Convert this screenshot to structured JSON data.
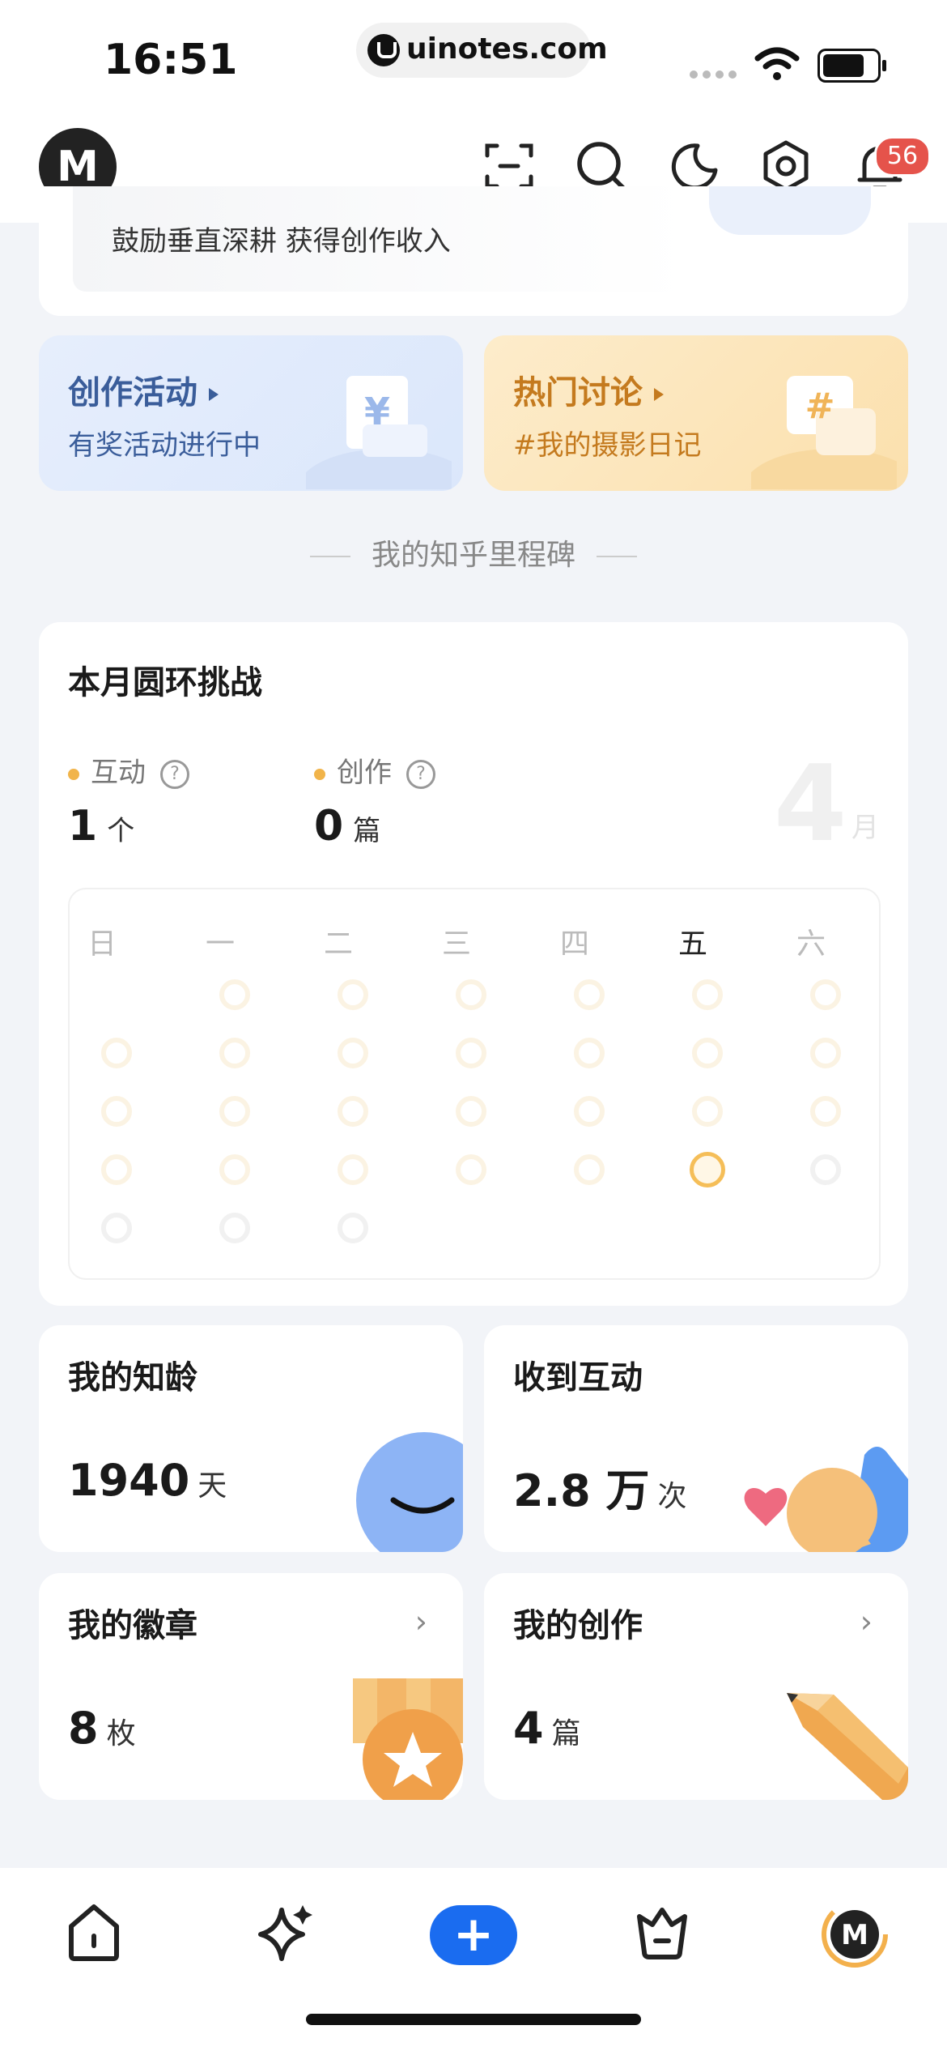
{
  "status_bar": {
    "time": "16:51",
    "url": "uinotes.com"
  },
  "header": {
    "logo_text": "M",
    "notification_count": "56"
  },
  "top_card": {
    "text": "鼓励垂直深耕 获得创作收入"
  },
  "promos": [
    {
      "title": "创作活动",
      "subtitle": "有奖活动进行中",
      "accent": "#3a5d9a",
      "icon": "yen-icon"
    },
    {
      "title": "热门讨论",
      "subtitle": "#我的摄影日记",
      "accent": "#c47a1e",
      "icon": "hash-icon"
    }
  ],
  "section_title": "我的知乎里程碑",
  "challenge": {
    "title": "本月圆环挑战",
    "stats": [
      {
        "label": "互动",
        "value": "1",
        "unit": "个"
      },
      {
        "label": "创作",
        "value": "0",
        "unit": "篇"
      }
    ],
    "month_number": "4",
    "month_unit": "月",
    "weekdays": [
      "日",
      "一",
      "二",
      "三",
      "四",
      "五",
      "六"
    ],
    "today_weekday_index": 5
  },
  "cards": {
    "age": {
      "title": "我的知龄",
      "value": "1940",
      "unit": "天"
    },
    "interactions": {
      "title": "收到互动",
      "value": "2.8 万",
      "unit": "次"
    },
    "badges": {
      "title": "我的徽章",
      "value": "8",
      "unit": "枚"
    },
    "creations": {
      "title": "我的创作",
      "value": "4",
      "unit": "篇"
    }
  },
  "tabbar": {
    "plus_label": "+"
  },
  "colors": {
    "brand_blue": "#1a6cf0",
    "ring_orange": "#f5be58",
    "badge_red": "#e5534b"
  }
}
